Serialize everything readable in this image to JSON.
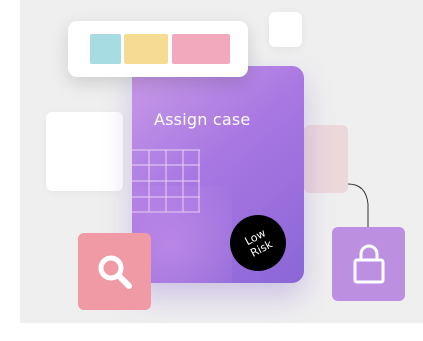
{
  "card": {
    "title": "Assign case"
  },
  "risk_badge": {
    "label": "Low\nRisk"
  },
  "palette": {
    "colors": [
      "#a7dce3",
      "#f6dc93",
      "#f2a9be"
    ]
  },
  "icons": {
    "search": "search-icon",
    "lock": "lock-icon"
  },
  "colors": {
    "card_gradient_start": "#c99be7",
    "card_gradient_end": "#8b66d6",
    "search_tile": "#ef9aa5",
    "lock_tile": "#bd8fe0",
    "pink_tile": "#ecd8db",
    "badge": "#000000"
  }
}
